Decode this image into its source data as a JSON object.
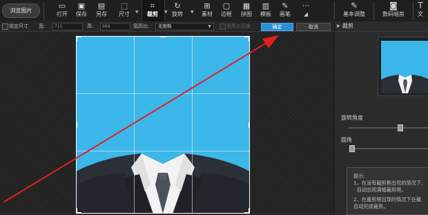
{
  "toolbar": {
    "browse": "浏览图片",
    "tools": [
      {
        "name": "open",
        "label": "打开",
        "icon": "folder-open-icon",
        "glyph": "▭"
      },
      {
        "name": "save",
        "label": "保存",
        "icon": "save-icon",
        "glyph": "▣"
      },
      {
        "name": "save-as",
        "label": "另存",
        "icon": "save-as-icon",
        "glyph": "▤"
      },
      {
        "name": "size",
        "label": "尺寸",
        "icon": "resize-icon",
        "glyph": "⬚"
      },
      {
        "name": "crop",
        "label": "裁剪",
        "icon": "crop-icon",
        "glyph": "⌗"
      },
      {
        "name": "rotate",
        "label": "旋转",
        "icon": "rotate-icon",
        "glyph": "↻"
      },
      {
        "name": "material",
        "label": "素材",
        "icon": "material-icon",
        "glyph": "⊞"
      },
      {
        "name": "border",
        "label": "边框",
        "icon": "border-icon",
        "glyph": "▢"
      },
      {
        "name": "collage",
        "label": "拼图",
        "icon": "collage-icon",
        "glyph": "▦"
      },
      {
        "name": "template",
        "label": "模板",
        "icon": "template-icon",
        "glyph": "▥"
      },
      {
        "name": "brush",
        "label": "画笔",
        "icon": "brush-icon",
        "glyph": "✎"
      },
      {
        "name": "more",
        "label": "···",
        "icon": "more-icon",
        "glyph": ""
      }
    ],
    "right_tools": [
      {
        "name": "basic-adjust",
        "label": "基本调整",
        "icon": "basic-adjust-icon",
        "glyph": "✎"
      },
      {
        "name": "digital-darkroom",
        "label": "数码暗房",
        "icon": "camera-icon",
        "glyph": "◙"
      },
      {
        "name": "text",
        "label": "文",
        "icon": "text-icon",
        "glyph": "T"
      }
    ]
  },
  "options": {
    "lock_size": "锁定尺寸",
    "width_label": "宽:",
    "width_value": "715",
    "height_label": "高:",
    "height_value": "969",
    "ratio_label": "宽高比:",
    "ratio_value": "无限制",
    "swap_label": "宽高比互换",
    "ok": "确定",
    "cancel": "取消"
  },
  "panel": {
    "title": "裁剪",
    "rotate_label": "旋转角度",
    "round_label": "圆角",
    "tips": [
      "提示:",
      "1、在没有裁剪框出现的情况下,",
      "· 自动出现满幅裁剪框。",
      "",
      "2、在裁剪框出现的情况下在裁",
      "自动完成裁剪。"
    ]
  },
  "colors": {
    "accent": "#2c8fd6",
    "photo_bg": "#3bb7ea",
    "arrow": "#e02020"
  }
}
